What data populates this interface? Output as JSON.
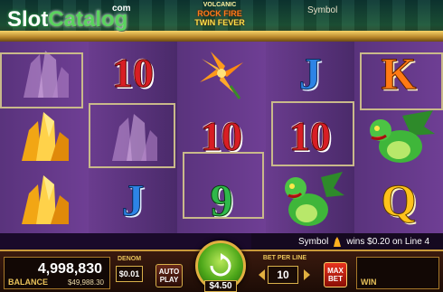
{
  "watermark": {
    "brand": "Slot",
    "brand_accent": "Catalog",
    "tld": "com"
  },
  "game_logo": {
    "line1": "VOLCANIC",
    "line2": "ROCK FIRE",
    "line3": "TWIN FEVER"
  },
  "top_right": {
    "label": "Symbol"
  },
  "colors": {
    "accent_gold": "#e2b040",
    "spin_green": "#4ea81a",
    "ten_red": "#d81e24"
  },
  "reels": [
    [
      "amethyst-crystal",
      "amber-crystal",
      "amber-crystal"
    ],
    [
      "10",
      "amethyst-crystal",
      "J"
    ],
    [
      "orange-lily",
      "10",
      "9"
    ],
    [
      "J",
      "10",
      "green-dragon"
    ],
    [
      "K",
      "green-dragon",
      "Q"
    ]
  ],
  "win_message": {
    "prefix": "Symbol",
    "text": "wins $0.20 on Line 4"
  },
  "controls": {
    "balance_value": "4,998,830",
    "balance_label": "BALANCE",
    "balance_dollars": "$49,988.30",
    "denom_label": "DENOM",
    "denom_value": "$0.01",
    "auto_play_label": "AUTO PLAY",
    "spin_cost": "$4.50",
    "bet_per_line_label": "BET PER LINE",
    "bet_per_line_value": "10",
    "max_bet_label": "MAX BET",
    "win_label": "WIN"
  }
}
